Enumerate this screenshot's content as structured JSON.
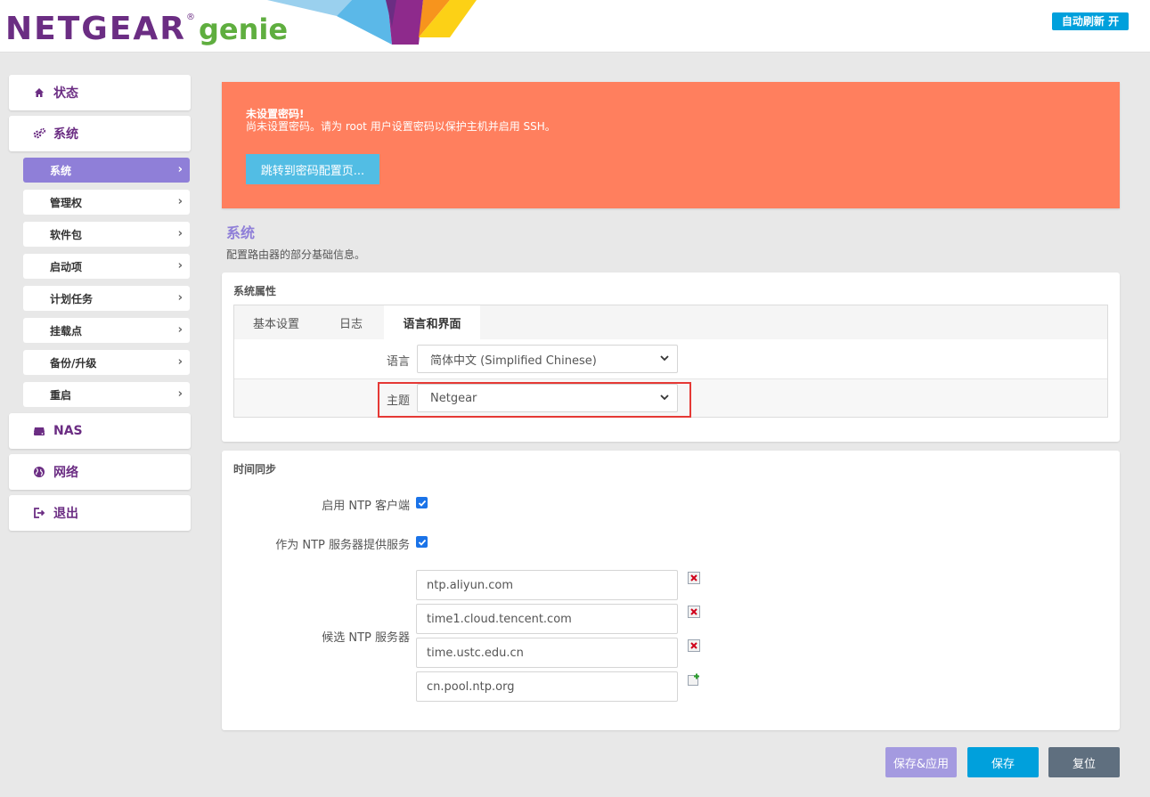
{
  "header": {
    "brand": "NETGEAR",
    "registered": "®",
    "product": "genie",
    "refresh_badge": "自动刷新 开"
  },
  "sidebar": {
    "main_items": [
      {
        "label": "状态",
        "icon": "home-icon"
      },
      {
        "label": "系统",
        "icon": "gears-icon"
      },
      {
        "label": "NAS",
        "icon": "hdd-icon"
      },
      {
        "label": "网络",
        "icon": "globe-icon"
      },
      {
        "label": "退出",
        "icon": "logout-icon"
      }
    ],
    "sub_items": [
      {
        "label": "系统",
        "active": true
      },
      {
        "label": "管理权"
      },
      {
        "label": "软件包"
      },
      {
        "label": "启动项"
      },
      {
        "label": "计划任务"
      },
      {
        "label": "挂载点"
      },
      {
        "label": "备份/升级"
      },
      {
        "label": "重启"
      }
    ],
    "chevron": "›"
  },
  "alert": {
    "title": "未设置密码!",
    "message": "尚未设置密码。请为 root 用户设置密码以保护主机并启用 SSH。",
    "button": "跳转到密码配置页..."
  },
  "page": {
    "title": "系统",
    "description": "配置路由器的部分基础信息。"
  },
  "system_properties": {
    "title": "系统属性",
    "tabs": [
      "基本设置",
      "日志",
      "语言和界面"
    ],
    "active_tab": "语言和界面",
    "language_label": "语言",
    "language_value": "简体中文 (Simplified Chinese)",
    "theme_label": "主题",
    "theme_value": "Netgear"
  },
  "time_sync": {
    "title": "时间同步",
    "ntp_client_label": "启用 NTP 客户端",
    "ntp_client_checked": true,
    "ntp_server_label": "作为 NTP 服务器提供服务",
    "ntp_server_checked": true,
    "candidate_label": "候选 NTP 服务器",
    "servers": [
      "ntp.aliyun.com",
      "time1.cloud.tencent.com",
      "time.ustc.edu.cn",
      "cn.pool.ntp.org"
    ]
  },
  "actions": {
    "save_apply": "保存&应用",
    "save": "保存",
    "reset": "复位"
  },
  "colors": {
    "brand_purple": "#6b2d83",
    "genie_green": "#5fae3f",
    "accent_purple": "#8f7fd8",
    "alert_orange": "#ff7f5e",
    "button_blue": "#00a0dc",
    "reset_gray": "#5f6f7f"
  }
}
